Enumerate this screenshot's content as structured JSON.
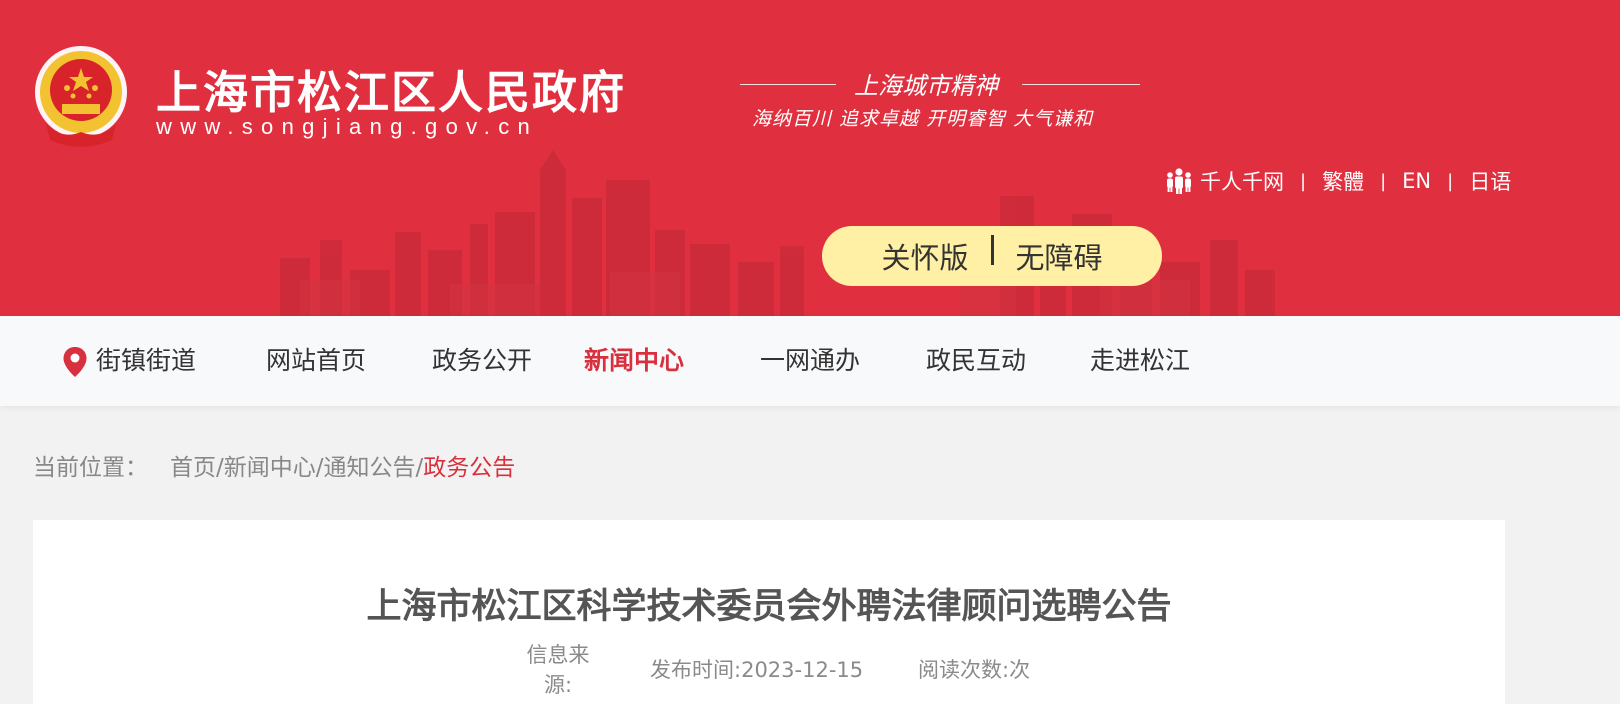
{
  "header": {
    "site_name": "上海市松江区人民政府",
    "site_url": "www.songjiang.gov.cn",
    "spirit_title": "上海城市精神",
    "spirit_subtitle": "海纳百川  追求卓越  开明睿智  大气谦和",
    "links": {
      "qianren": "千人千网",
      "traditional": "繁體",
      "english": "EN",
      "japanese": "日语"
    },
    "separator": "|",
    "care": {
      "caring_mode": "关怀版",
      "accessibility": "无障碍"
    }
  },
  "nav": {
    "streets": "街镇街道",
    "items": [
      "网站首页",
      "政务公开",
      "新闻中心",
      "一网通办",
      "政民互动",
      "走进松江"
    ],
    "active": "新闻中心"
  },
  "breadcrumb": {
    "label": "当前位置：",
    "path": "首页/新闻中心/通知公告/",
    "current": "政务公告"
  },
  "article": {
    "title": "上海市松江区科学技术委员会外聘法律顾问选聘公告",
    "source_label": "信息来源:",
    "publish_label": "发布时间:",
    "publish_date": "2023-12-15",
    "views_label": "阅读次数:",
    "views_unit": "次"
  },
  "colors": {
    "header_red": "#e03040",
    "accent_red": "#d8303e",
    "care_yellow": "#fff0a5",
    "emblem_gold": "#f2c230"
  }
}
